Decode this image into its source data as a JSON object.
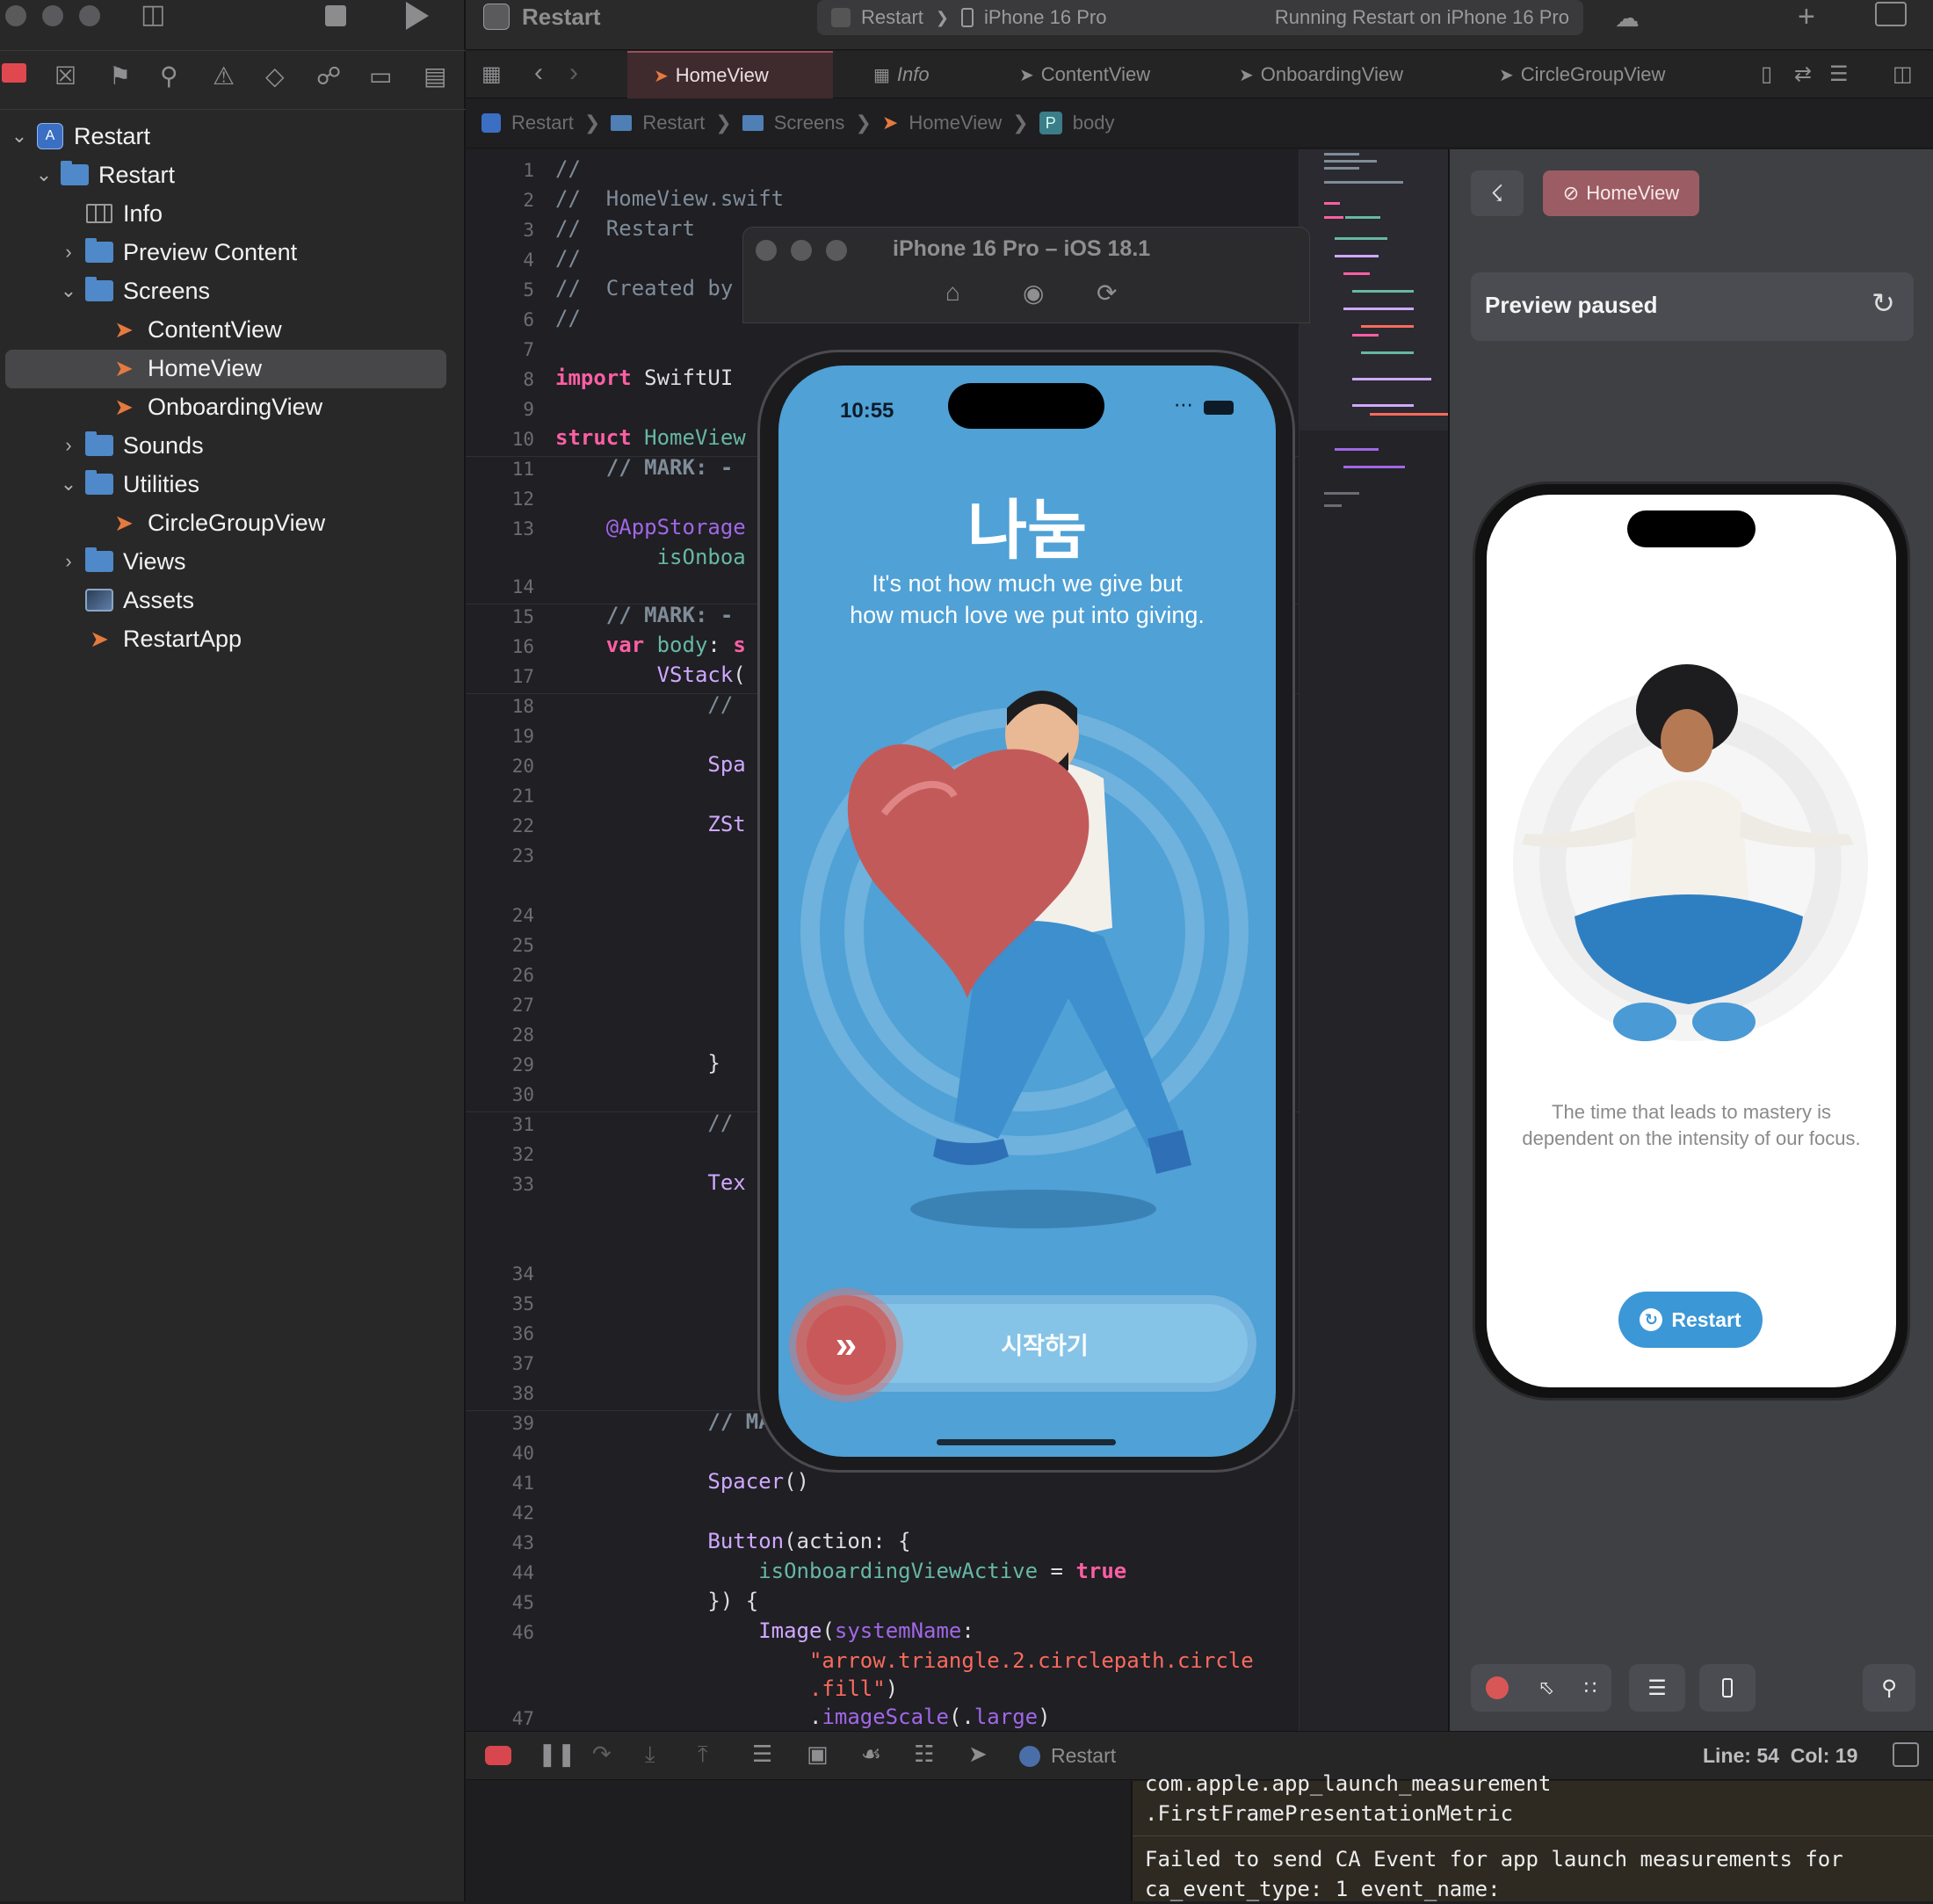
{
  "window": {
    "title": "Restart"
  },
  "scheme": {
    "project": "Restart",
    "device": "iPhone 16 Pro",
    "status": "Running Restart on iPhone 16 Pro"
  },
  "navigator": {
    "items": [
      {
        "label": "Restart",
        "kind": "project",
        "depth": 0,
        "expanded": true
      },
      {
        "label": "Restart",
        "kind": "folder",
        "depth": 1,
        "expanded": true
      },
      {
        "label": "Info",
        "kind": "plist",
        "depth": 2
      },
      {
        "label": "Preview Content",
        "kind": "folder",
        "depth": 2,
        "expanded": false
      },
      {
        "label": "Screens",
        "kind": "folder",
        "depth": 2,
        "expanded": true
      },
      {
        "label": "ContentView",
        "kind": "swift",
        "depth": 3
      },
      {
        "label": "HomeView",
        "kind": "swift",
        "depth": 3,
        "selected": true
      },
      {
        "label": "OnboardingView",
        "kind": "swift",
        "depth": 3
      },
      {
        "label": "Sounds",
        "kind": "folder",
        "depth": 2,
        "expanded": false
      },
      {
        "label": "Utilities",
        "kind": "folder",
        "depth": 2,
        "expanded": true
      },
      {
        "label": "CircleGroupView",
        "kind": "swift",
        "depth": 3
      },
      {
        "label": "Views",
        "kind": "folder",
        "depth": 2,
        "expanded": false
      },
      {
        "label": "Assets",
        "kind": "assets",
        "depth": 2
      },
      {
        "label": "RestartApp",
        "kind": "swift",
        "depth": 2
      }
    ]
  },
  "tabs": [
    {
      "label": "HomeView",
      "active": true
    },
    {
      "label": "Info"
    },
    {
      "label": "ContentView"
    },
    {
      "label": "OnboardingView"
    },
    {
      "label": "CircleGroupView"
    }
  ],
  "breadcrumb": [
    "Restart",
    "Restart",
    "Screens",
    "HomeView",
    "body"
  ],
  "editor": {
    "lines": [
      {
        "n": "1",
        "html": "<span class='cm'>//</span>"
      },
      {
        "n": "2",
        "html": "<span class='cm'>//  HomeView.swift</span>"
      },
      {
        "n": "3",
        "html": "<span class='cm'>//  Restart</span>"
      },
      {
        "n": "4",
        "html": "<span class='cm'>//</span>"
      },
      {
        "n": "5",
        "html": "<span class='cm'>//  Created by</span>"
      },
      {
        "n": "6",
        "html": "<span class='cm'>//</span>"
      },
      {
        "n": "7",
        "html": ""
      },
      {
        "n": "8",
        "html": "<span class='kw'>import</span> SwiftUI"
      },
      {
        "n": "9",
        "html": ""
      },
      {
        "n": "10",
        "html": "<span class='kw'>struct</span> <span class='fn'>HomeView</span>"
      },
      {
        "n": "11",
        "html": "    <span class='cm'><b>// MARK: -</b></span>"
      },
      {
        "n": "12",
        "html": ""
      },
      {
        "n": "13",
        "html": "    <span class='pr'>@AppStorage</span>"
      },
      {
        "n": "",
        "html": "        <span class='fn'>isOnboa</span>"
      },
      {
        "n": "14",
        "html": ""
      },
      {
        "n": "15",
        "html": "    <span class='cm'><b>// MARK: -</b></span>"
      },
      {
        "n": "16",
        "html": "    <span class='kw'>var</span> <span class='fn'>body</span>: <span class='kw'>s</span>"
      },
      {
        "n": "17",
        "html": "        <span class='ty'>VStack</span>("
      },
      {
        "n": "18",
        "html": "            <span class='cm'>//</span>"
      },
      {
        "n": "19",
        "html": ""
      },
      {
        "n": "20",
        "html": "            <span class='ty'>Spa</span>"
      },
      {
        "n": "21",
        "html": ""
      },
      {
        "n": "22",
        "html": "            <span class='ty'>ZSt</span>"
      },
      {
        "n": "23",
        "html": ""
      },
      {
        "n": "24",
        "html": ""
      },
      {
        "n": "25",
        "html": ""
      },
      {
        "n": "26",
        "html": ""
      },
      {
        "n": "27",
        "html": ""
      },
      {
        "n": "28",
        "html": ""
      },
      {
        "n": "29",
        "html": "            }"
      },
      {
        "n": "30",
        "html": ""
      },
      {
        "n": "31",
        "html": "            <span class='cm'>//</span>"
      },
      {
        "n": "32",
        "html": ""
      },
      {
        "n": "33",
        "html": "            <span class='ty'>Tex</span>"
      },
      {
        "n": "34",
        "html": ""
      },
      {
        "n": "35",
        "html": ""
      },
      {
        "n": "36",
        "html": ""
      },
      {
        "n": "37",
        "html": ""
      },
      {
        "n": "38",
        "html": ""
      },
      {
        "n": "39",
        "html": "            <span class='cm'><b>// MA</b></span>"
      },
      {
        "n": "40",
        "html": ""
      },
      {
        "n": "41",
        "html": "            <span class='ty'>Spacer</span>()"
      },
      {
        "n": "42",
        "html": ""
      },
      {
        "n": "43",
        "html": "            <span class='ty'>Button</span>(action: {"
      },
      {
        "n": "44",
        "html": "                <span class='fn'>isOnboardingViewActive</span> = <span class='kw'>true</span>"
      },
      {
        "n": "45",
        "html": "            }) {"
      },
      {
        "n": "46",
        "html": "                <span class='ty'>Image</span>(<span class='pr'>systemName</span>:"
      },
      {
        "n": "",
        "html": "                    <span class='st'>\"arrow.triangle.2.circlepath.circle</span>"
      },
      {
        "n": "",
        "html": "                    <span class='st'>.fill\"</span>)"
      },
      {
        "n": "47",
        "html": "                    .<span class='pr'>imageScale</span>(.<span class='pr'>large</span>)"
      }
    ]
  },
  "simulator": {
    "title": "iPhone 16 Pro – iOS 18.1",
    "time": "10:55",
    "heading": "나눔",
    "subtitle_line1": "It's not how much we give but",
    "subtitle_line2": "how much love we put into giving.",
    "button_label": "시작하기",
    "background": "#4fa1d6"
  },
  "preview": {
    "pin_icon": "pin-icon",
    "chip_label": "HomeView",
    "paused_label": "Preview paused",
    "quote_line1": "The time that leads to mastery is",
    "quote_line2": "dependent on the intensity of our focus.",
    "restart_label": "Restart"
  },
  "debugbar": {
    "target": "Restart",
    "line": "Line: 54",
    "col": "Col: 19"
  },
  "console": {
    "lines": [
      "com.apple.app_launch_measurement",
      ".FirstFramePresentationMetric",
      "Failed to send CA Event for app launch measurements for",
      "ca_event_type: 1 event_name:"
    ]
  }
}
